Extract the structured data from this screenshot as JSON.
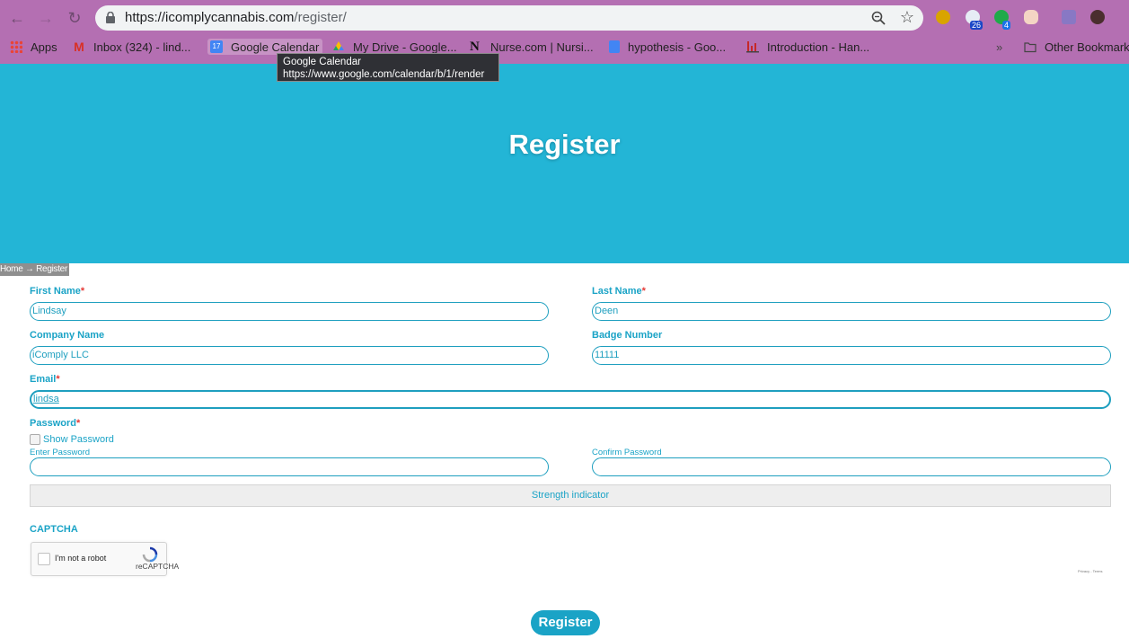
{
  "browser": {
    "url_host": "https://icomplycannabis.com",
    "url_path": "/register/",
    "extension_badges": [
      "26",
      "4"
    ],
    "bookmarks": [
      "Apps",
      "Inbox (324) - lind...",
      "Google Calendar",
      "My Drive - Google...",
      "Nurse.com | Nursi...",
      "hypothesis - Goo...",
      "Introduction - Han..."
    ],
    "other_bookmarks": "Other Bookmarks",
    "overflow": "»",
    "tooltip": {
      "title": "Google Calendar",
      "url": "https://www.google.com/calendar/b/1/render"
    },
    "calendar_day": "17"
  },
  "page": {
    "title": "Register",
    "breadcrumb": "Home → Register"
  },
  "form": {
    "first_name": {
      "label": "First Name",
      "value": "Lindsay"
    },
    "last_name": {
      "label": "Last Name",
      "value": "Deen"
    },
    "company_name": {
      "label": "Company Name",
      "value": "iComply LLC"
    },
    "badge_number": {
      "label": "Badge Number",
      "value": "11111"
    },
    "email": {
      "label": "Email",
      "value": "lindsa"
    },
    "password": {
      "label": "Password",
      "show_password": "Show Password",
      "enter_label": "Enter Password",
      "confirm_label": "Confirm Password"
    },
    "required_mark": "*",
    "strength_indicator": "Strength indicator",
    "captcha": {
      "heading": "CAPTCHA",
      "checkbox_label": "I'm not a robot",
      "brand": "reCAPTCHA",
      "terms": "Privacy - Terms"
    },
    "submit_label": "Register"
  },
  "colors": {
    "hero": "#23b5d6",
    "accent": "#1aa3c6",
    "browser_chrome": "#b46fb2"
  }
}
